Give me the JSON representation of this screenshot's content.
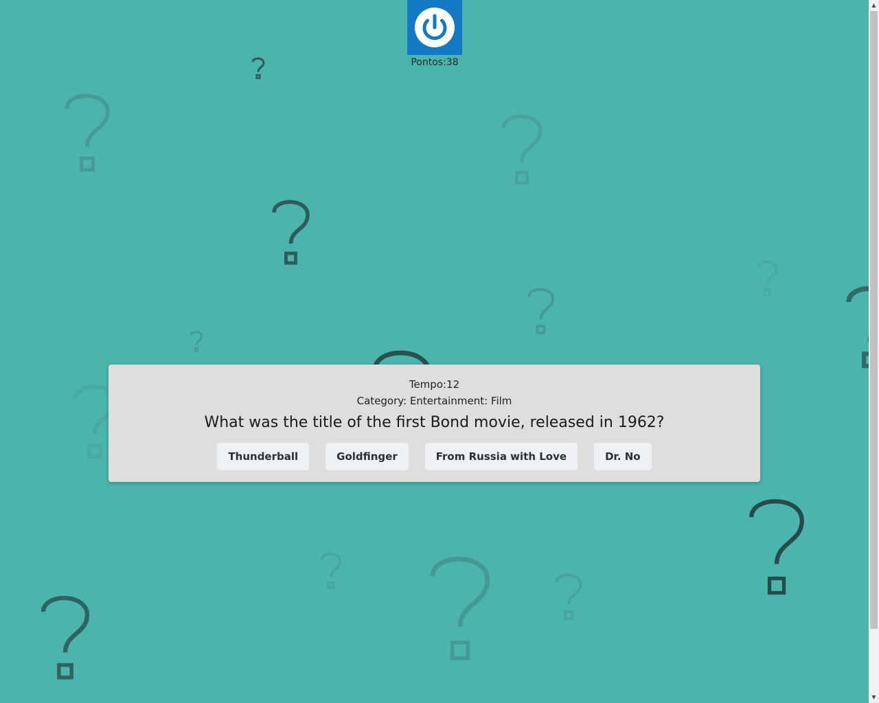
{
  "header": {
    "power_icon": "power-icon",
    "score_text": "Pontos:38"
  },
  "quiz": {
    "timer_text": "Tempo:12",
    "category_text": "Category: Entertainment: Film",
    "question": "What was the title of the first Bond movie, released in 1962?",
    "answers": [
      "Thunderball",
      "Goldfinger",
      "From Russia with Love",
      "Dr. No"
    ]
  },
  "colors": {
    "background": "#4db3ad",
    "power_button": "#1379c3",
    "card": "#dedede",
    "answer_button": "#edf1f5"
  },
  "background_decoration": "question-mark-icon"
}
